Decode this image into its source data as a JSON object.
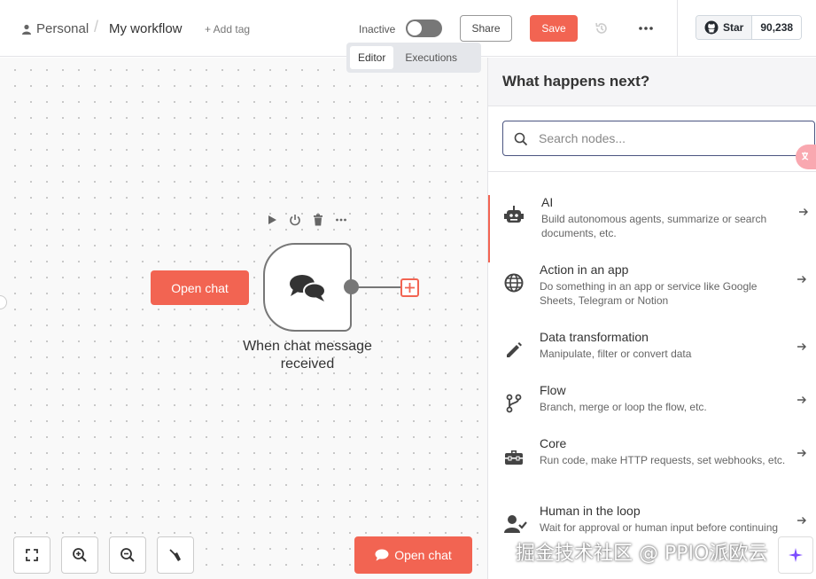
{
  "header": {
    "breadcrumb_personal": "Personal",
    "breadcrumb_separator": "/",
    "workflow_name": "My workflow",
    "add_tag": "+ Add tag",
    "status_label": "Inactive",
    "share_label": "Share",
    "save_label": "Save",
    "github_star_label": "Star",
    "github_star_count": "90,238"
  },
  "tabs": [
    {
      "label": "Editor",
      "active": true
    },
    {
      "label": "Executions",
      "active": false
    }
  ],
  "canvas": {
    "open_chat_label": "Open chat",
    "node_label": "When chat message received",
    "open_chat_bottom_label": "Open chat"
  },
  "panel": {
    "title": "What happens next?",
    "search_placeholder": "Search nodes...",
    "categories": [
      {
        "title": "AI",
        "description": "Build autonomous agents, summarize or search documents, etc.",
        "icon": "robot-icon"
      },
      {
        "title": "Action in an app",
        "description": "Do something in an app or service like Google Sheets, Telegram or Notion",
        "icon": "globe-icon"
      },
      {
        "title": "Data transformation",
        "description": "Manipulate, filter or convert data",
        "icon": "pen-icon"
      },
      {
        "title": "Flow",
        "description": "Branch, merge or loop the flow, etc.",
        "icon": "branch-icon"
      },
      {
        "title": "Core",
        "description": "Run code, make HTTP requests, set webhooks, etc.",
        "icon": "toolbox-icon"
      },
      {
        "title": "Human in the loop",
        "description": "Wait for approval or human input before continuing",
        "icon": "user-check-icon"
      }
    ]
  },
  "watermark": "掘金技术社区 @ PPIO派欧云",
  "colors": {
    "accent": "#f26452",
    "search_border": "#4b5581"
  }
}
